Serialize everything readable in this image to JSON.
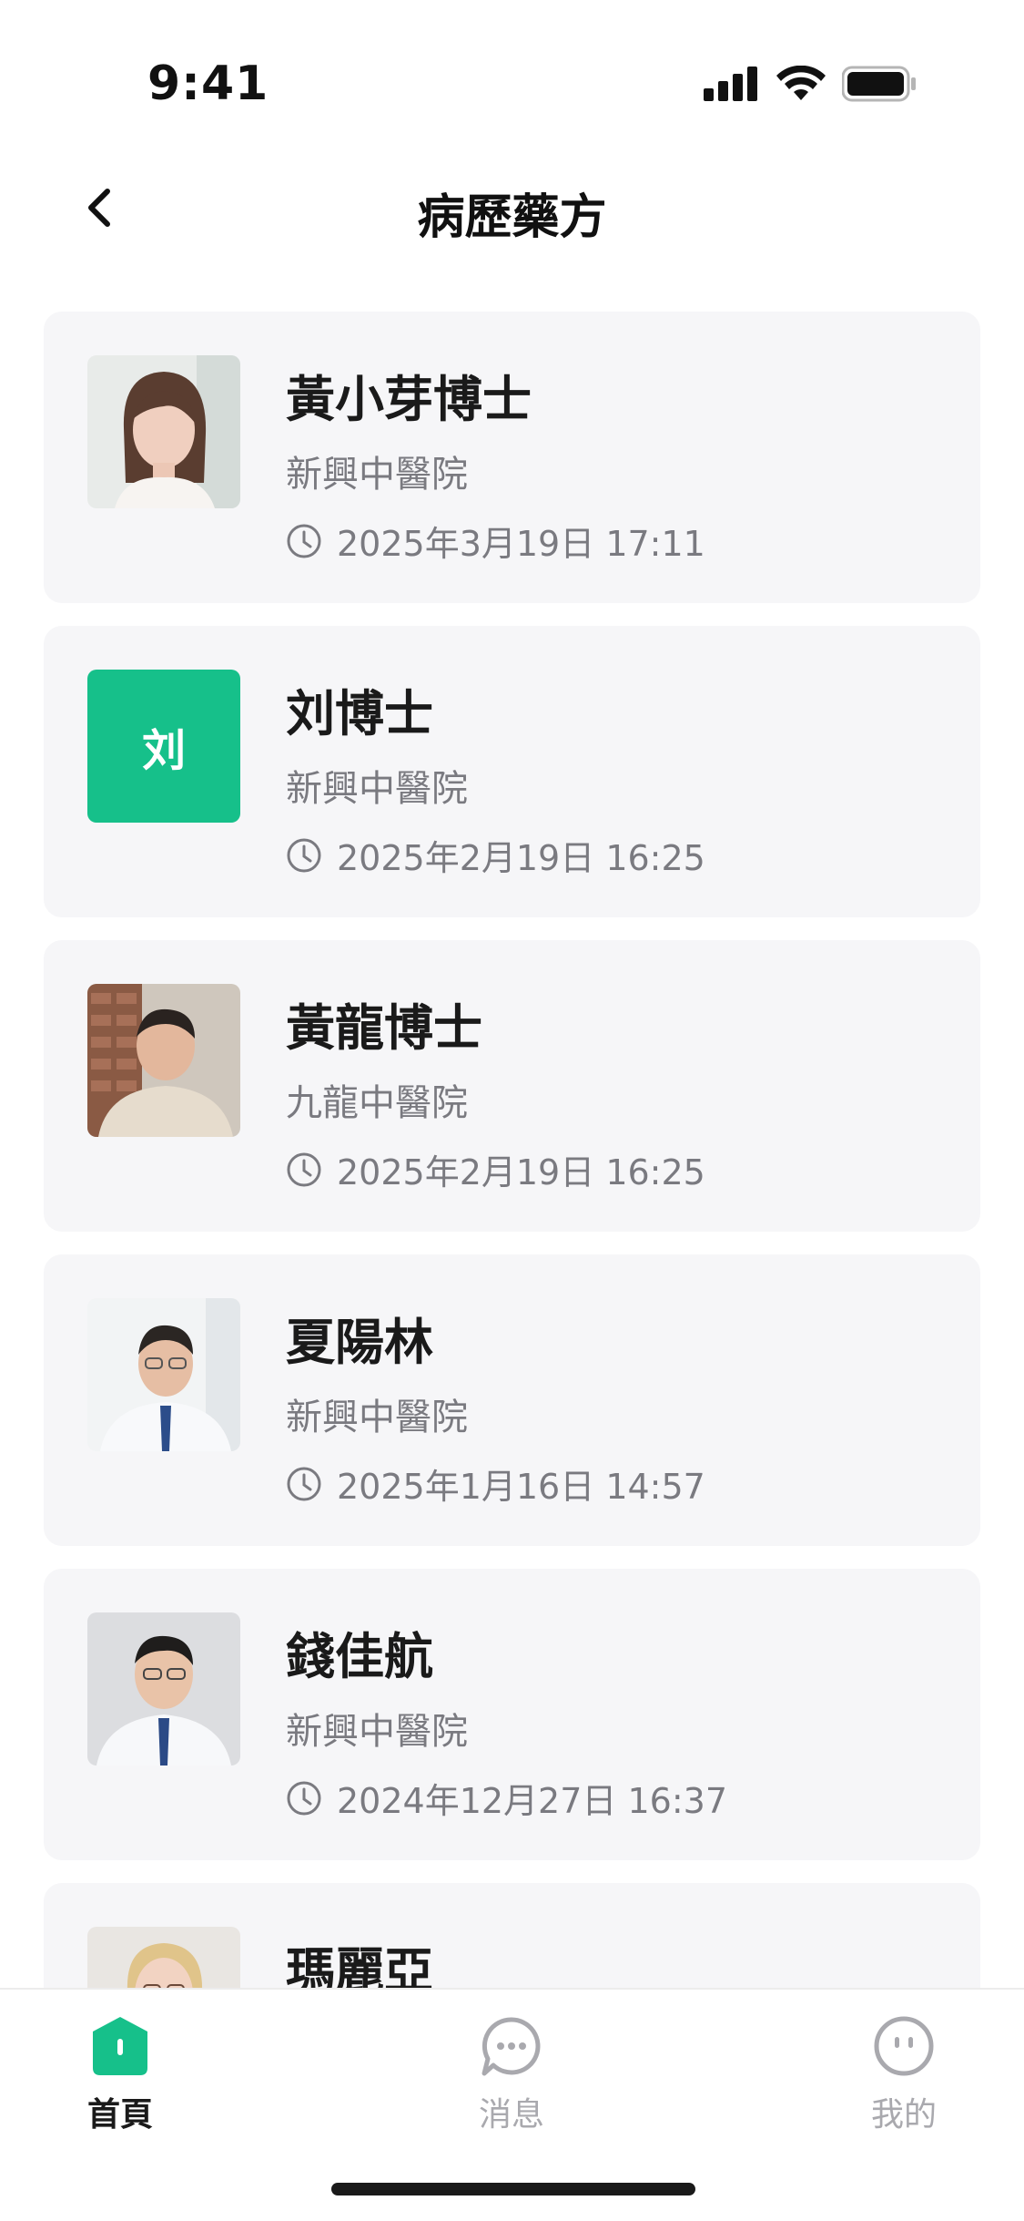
{
  "status_bar": {
    "time": "9:41"
  },
  "header": {
    "title": "病歷藥方"
  },
  "records": [
    {
      "name": "黃小芽博士",
      "hospital": "新興中醫院",
      "time": "2025年3月19日 17:11",
      "avatar": "photo-woman"
    },
    {
      "name": "刘博士",
      "hospital": "新興中醫院",
      "time": "2025年2月19日 16:25",
      "avatar": "initial",
      "initial": "刘"
    },
    {
      "name": "黃龍博士",
      "hospital": "九龍中醫院",
      "time": "2025年2月19日 16:25",
      "avatar": "photo-elder"
    },
    {
      "name": "夏陽林",
      "hospital": "新興中醫院",
      "time": "2025年1月16日 14:57",
      "avatar": "photo-doctor-glasses"
    },
    {
      "name": "錢佳航",
      "hospital": "新興中醫院",
      "time": "2024年12月27日 16:37",
      "avatar": "photo-doctor"
    },
    {
      "name": "瑪麗亞",
      "hospital": "",
      "time": "",
      "avatar": "photo-blonde"
    }
  ],
  "tab_bar": {
    "tabs": [
      {
        "label": "首頁",
        "icon": "home-icon",
        "active": true
      },
      {
        "label": "消息",
        "icon": "chat-icon",
        "active": false
      },
      {
        "label": "我的",
        "icon": "profile-icon",
        "active": false
      }
    ]
  },
  "colors": {
    "accent": "#16c08a",
    "card_bg": "#f6f6f8",
    "muted_text": "#7a7a80"
  }
}
